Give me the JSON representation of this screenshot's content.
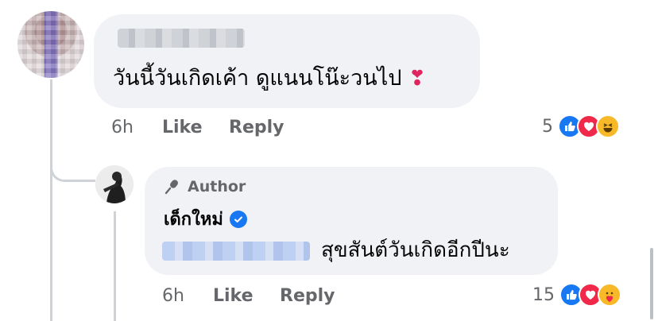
{
  "comments": [
    {
      "text": "วันนี้วันเกิดเค้า ดูแนนโน๊ะวนไป",
      "time": "6h",
      "like_label": "Like",
      "reply_label": "Reply",
      "reaction_count": "5",
      "reactions": [
        "like",
        "love",
        "haha"
      ]
    },
    {
      "author_label": "Author",
      "author_name": "เด็กใหม่",
      "text": "สุขสันต์วันเกิดอีกปีนะ",
      "time": "6h",
      "like_label": "Like",
      "reply_label": "Reply",
      "reaction_count": "15",
      "reactions": [
        "like",
        "love",
        "care"
      ]
    }
  ],
  "colors": {
    "bubble": "#f0f2f5",
    "meta": "#65676b",
    "accent": "#1877f2",
    "love": "#f02849",
    "haha": "#f7b928"
  }
}
